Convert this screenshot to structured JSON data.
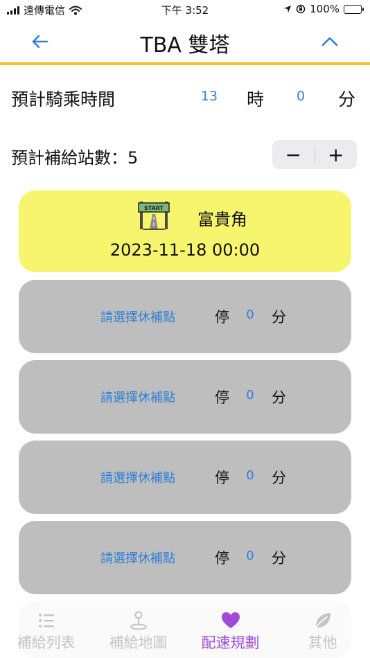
{
  "status_bar": {
    "carrier": "遠傳電信",
    "time": "下午 3:52",
    "battery": "100%"
  },
  "header": {
    "title": "TBA 雙塔",
    "back_icon": "arrow-left-icon",
    "collapse_icon": "chevron-up-icon",
    "accent_color": "#f2c02a"
  },
  "ride_time": {
    "label": "預計騎乘時間",
    "hours": "13",
    "hours_unit": "時",
    "minutes": "0",
    "minutes_unit": "分"
  },
  "supply_count": {
    "label": "預計補給站數：5",
    "minus": "−",
    "plus": "+"
  },
  "start": {
    "icon": "start-gate-icon",
    "icon_text": "START",
    "place": "富貴角",
    "datetime": "2023-11-18 00:00",
    "color": "#f7f56d"
  },
  "stops": [
    {
      "pick_label": "請選擇休補點",
      "stop_label": "停",
      "minutes": "0",
      "unit": "分"
    },
    {
      "pick_label": "請選擇休補點",
      "stop_label": "停",
      "minutes": "0",
      "unit": "分"
    },
    {
      "pick_label": "請選擇休補點",
      "stop_label": "停",
      "minutes": "0",
      "unit": "分"
    },
    {
      "pick_label": "請選擇休補點",
      "stop_label": "停",
      "minutes": "0",
      "unit": "分"
    }
  ],
  "tabs": [
    {
      "label": "補給列表",
      "icon": "list-icon",
      "active": false
    },
    {
      "label": "補給地圖",
      "icon": "map-pin-icon",
      "active": false
    },
    {
      "label": "配速規劃",
      "icon": "heart-icon",
      "active": true
    },
    {
      "label": "其他",
      "icon": "leaf-icon",
      "active": false
    }
  ],
  "colors": {
    "link": "#2f7ed8",
    "active_tab": "#a04ad8",
    "inactive_tab": "#c4c4c4",
    "stop_card": "#bebebe"
  }
}
